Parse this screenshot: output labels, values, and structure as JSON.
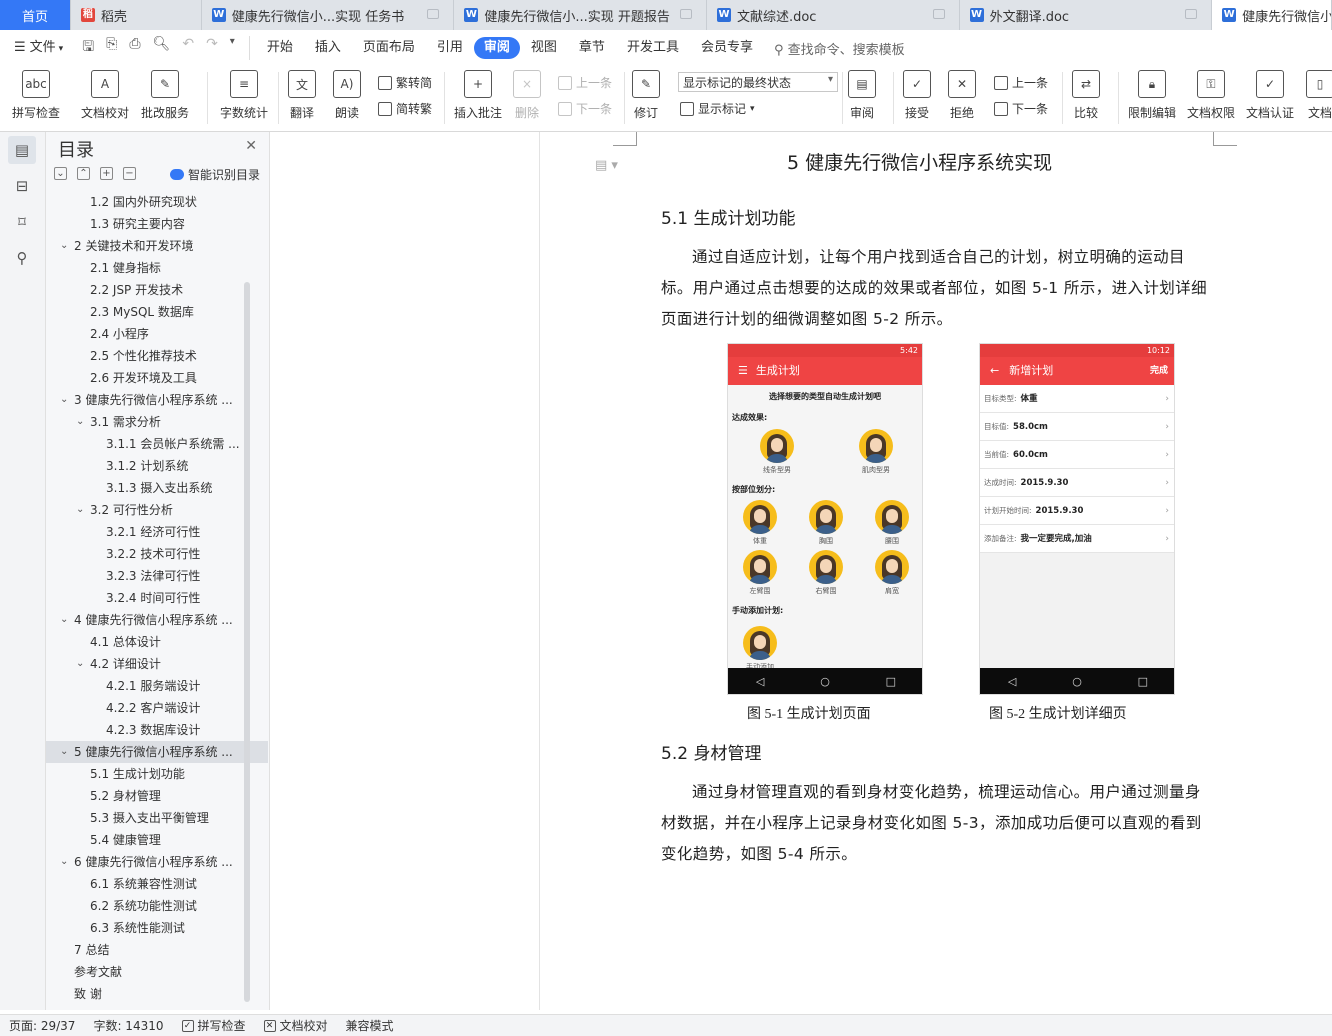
{
  "tabs": [
    {
      "label": "首页",
      "type": "home"
    },
    {
      "label": "稻壳",
      "type": "daoke"
    },
    {
      "label": "健康先行微信小...实现 任务书",
      "type": "doc"
    },
    {
      "label": "健康先行微信小...实现 开题报告",
      "type": "doc"
    },
    {
      "label": "文献综述.doc",
      "type": "doc"
    },
    {
      "label": "外文翻译.doc",
      "type": "doc"
    },
    {
      "label": "健康先行微信小",
      "type": "active"
    }
  ],
  "menubar": {
    "file": "文件",
    "items": [
      "开始",
      "插入",
      "页面布局",
      "引用",
      "审阅",
      "视图",
      "章节",
      "开发工具",
      "会员专享"
    ],
    "active": "审阅",
    "search": "查找命令、搜索模板"
  },
  "ribbon": {
    "spell_check": "拼写检查",
    "doc_proofread": "文档校对",
    "annotation_service": "批改服务",
    "word_count": "字数统计",
    "translate": "翻译",
    "read_aloud": "朗读",
    "trad_to_simp": "繁转简",
    "simp_to_trad": "简转繁",
    "insert_comment": "插入批注",
    "delete": "删除",
    "prev_comment": "上一条",
    "next_comment": "下一条",
    "revise": "修订",
    "markup_state": "显示标记的最终状态",
    "show_markup": "显示标记",
    "review": "审阅",
    "accept": "接受",
    "reject": "拒绝",
    "prev_change": "上一条",
    "next_change": "下一条",
    "compare": "比较",
    "restrict_edit": "限制编辑",
    "doc_permission": "文档权限",
    "doc_certify": "文档认证",
    "doc_more": "文档"
  },
  "toc": {
    "title": "目录",
    "smart": "智能识别目录",
    "items": [
      {
        "label": "1.2 国内外研究现状",
        "level": 2,
        "chev": false
      },
      {
        "label": "1.3 研究主要内容",
        "level": 2,
        "chev": false
      },
      {
        "label": "2 关键技术和开发环境",
        "level": 1,
        "chev": true
      },
      {
        "label": "2.1 健身指标",
        "level": 2,
        "chev": false
      },
      {
        "label": "2.2 JSP 开发技术",
        "level": 2,
        "chev": false
      },
      {
        "label": "2.3 MySQL 数据库",
        "level": 2,
        "chev": false
      },
      {
        "label": "2.4 小程序",
        "level": 2,
        "chev": false
      },
      {
        "label": "2.5 个性化推荐技术",
        "level": 2,
        "chev": false
      },
      {
        "label": "2.6 开发环境及工具",
        "level": 2,
        "chev": false
      },
      {
        "label": "3 健康先行微信小程序系统 ...",
        "level": 1,
        "chev": true
      },
      {
        "label": "3.1 需求分析",
        "level": 2,
        "chev": true
      },
      {
        "label": "3.1.1 会员帐户系统需 ...",
        "level": 3,
        "chev": false
      },
      {
        "label": "3.1.2 计划系统",
        "level": 3,
        "chev": false
      },
      {
        "label": "3.1.3 摄入支出系统",
        "level": 3,
        "chev": false
      },
      {
        "label": "3.2 可行性分析",
        "level": 2,
        "chev": true
      },
      {
        "label": "3.2.1 经济可行性",
        "level": 3,
        "chev": false
      },
      {
        "label": "3.2.2 技术可行性",
        "level": 3,
        "chev": false
      },
      {
        "label": "3.2.3 法律可行性",
        "level": 3,
        "chev": false
      },
      {
        "label": "3.2.4 时间可行性",
        "level": 3,
        "chev": false
      },
      {
        "label": "4 健康先行微信小程序系统 ...",
        "level": 1,
        "chev": true
      },
      {
        "label": "4.1 总体设计",
        "level": 2,
        "chev": false
      },
      {
        "label": "4.2 详细设计",
        "level": 2,
        "chev": true
      },
      {
        "label": "4.2.1 服务端设计",
        "level": 3,
        "chev": false
      },
      {
        "label": "4.2.2 客户端设计",
        "level": 3,
        "chev": false
      },
      {
        "label": "4.2.3 数据库设计",
        "level": 3,
        "chev": false
      },
      {
        "label": "5 健康先行微信小程序系统 ...",
        "level": 1,
        "chev": true,
        "selected": true
      },
      {
        "label": "5.1 生成计划功能",
        "level": 2,
        "chev": false
      },
      {
        "label": "5.2 身材管理",
        "level": 2,
        "chev": false
      },
      {
        "label": "5.3 摄入支出平衡管理",
        "level": 2,
        "chev": false
      },
      {
        "label": "5.4 健康管理",
        "level": 2,
        "chev": false
      },
      {
        "label": "6 健康先行微信小程序系统 ...",
        "level": 1,
        "chev": true
      },
      {
        "label": "6.1 系统兼容性测试",
        "level": 2,
        "chev": false
      },
      {
        "label": "6.2 系统功能性测试",
        "level": 2,
        "chev": false
      },
      {
        "label": "6.3 系统性能测试",
        "level": 2,
        "chev": false
      },
      {
        "label": "7 总结",
        "level": 1,
        "chev": false
      },
      {
        "label": "参考文献",
        "level": 1,
        "chev": false
      },
      {
        "label": "致  谢",
        "level": 1,
        "chev": false
      }
    ]
  },
  "document": {
    "chapter_title": "5  健康先行微信小程序系统实现",
    "section1_title": "5.1 生成计划功能",
    "section1_text": "通过自适应计划，让每个用户找到适合自己的计划，树立明确的运动目标。用户通过点击想要的达成的效果或者部位，如图 5-1 所示，进入计划详细页面进行计划的细微调整如图 5-2 所示。",
    "fig1_caption": "图 5-1  生成计划页面",
    "fig2_caption": "图 5-2  生成计划详细页",
    "section2_title": "5.2 身材管理",
    "section2_text": "通过身材管理直观的看到身材变化趋势，梳理运动信心。用户通过测量身材数据，并在小程序上记录身材变化如图 5-3，添加成功后便可以直观的看到变化趋势，如图 5-4 所示。"
  },
  "phone1": {
    "status": "5:42",
    "title": "生成计划",
    "heading": "选择想要的类型自动生成计划吧",
    "effect_label": "达成效果:",
    "effects": [
      "线条型男",
      "肌肉型男"
    ],
    "part_label": "按部位划分:",
    "parts": [
      "体重",
      "胸围",
      "腰围",
      "左臂围",
      "右臂围",
      "肩宽"
    ],
    "manual_label": "手动添加计划:",
    "manual": "手动添加",
    "nav": [
      "◁",
      "○",
      "□"
    ]
  },
  "phone2": {
    "status": "10:12",
    "title": "新增计划",
    "done": "完成",
    "rows": [
      {
        "key": "目标类型:",
        "value": "体重"
      },
      {
        "key": "目标值:",
        "value": "58.0cm"
      },
      {
        "key": "当前值:",
        "value": "60.0cm"
      },
      {
        "key": "达成时间:",
        "value": "2015.9.30"
      },
      {
        "key": "计划开始时间:",
        "value": "2015.9.30"
      },
      {
        "key": "添加备注:",
        "value": "我一定要完成,加油"
      }
    ],
    "nav": [
      "◁",
      "○",
      "□"
    ]
  },
  "statusbar": {
    "page": "页面: 29/37",
    "words": "字数: 14310",
    "spell": "拼写检查",
    "proof": "文档校对",
    "compat": "兼容模式"
  },
  "colors": {
    "accent": "#3478f6",
    "phone_red": "#ef4444",
    "avatar_yellow": "#f6bd1b"
  }
}
